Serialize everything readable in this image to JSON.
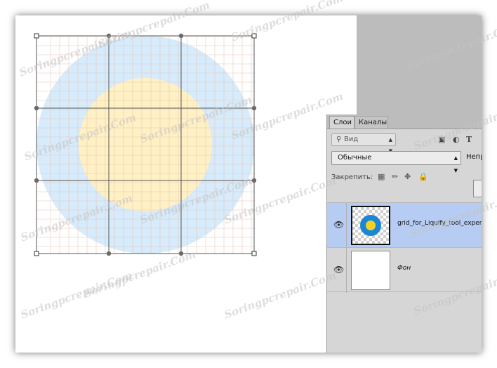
{
  "watermark": "Soringpcrepair.Com",
  "canvas": {
    "outer_color": "#d6ebfb",
    "inner_color": "#fff1c4",
    "grid_line_color": "#e9c7b9",
    "mesh_line_color": "#555555"
  },
  "layers_panel": {
    "tabs": [
      {
        "label": "Слои",
        "active": true
      },
      {
        "label": "Каналы",
        "active": false
      }
    ],
    "kind_filter": "Вид",
    "blend_mode": "Обычные",
    "opacity_label": "Непр",
    "lock_label": "Закрепить:",
    "filter_icons": [
      "image-icon",
      "adjustment-icon",
      "text-icon"
    ],
    "lock_icons": [
      "transparency-lock-icon",
      "brush-lock-icon",
      "move-lock-icon",
      "padlock-icon"
    ],
    "layers": [
      {
        "name": "grid_for_Liquify_tool_exper",
        "selected": true,
        "visible": true
      },
      {
        "name": "Фон",
        "selected": false,
        "visible": true
      }
    ],
    "selection_color": "#b7ccf2"
  }
}
